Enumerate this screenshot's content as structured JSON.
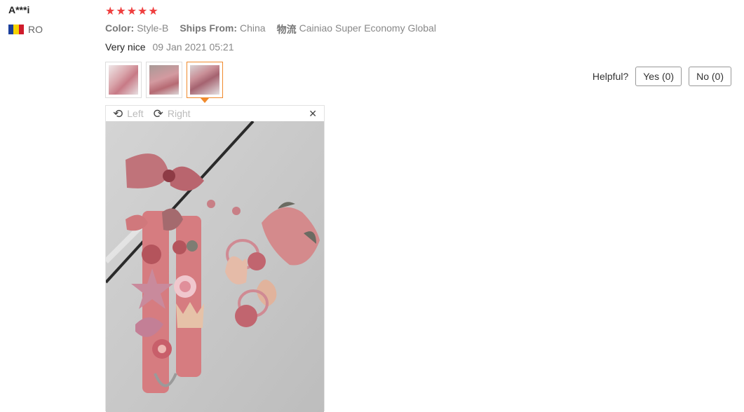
{
  "review": {
    "user_name": "A***i",
    "country_code": "RO",
    "flag_colors": [
      "#1a3e9c",
      "#f4d300",
      "#cf1b2b"
    ],
    "rating": 5,
    "color_label": "Color:",
    "color_value": "Style-B",
    "ships_label": "Ships From:",
    "ships_value": "China",
    "logistics_label": "物流",
    "logistics_value": "Cainiao Super Economy Global",
    "text": "Very nice",
    "date": "09 Jan 2021 05:21",
    "helpful_label": "Helpful?",
    "yes_label": "Yes (0)",
    "no_label": "No (0)"
  },
  "viewer": {
    "left_label": "Left",
    "right_label": "Right",
    "close_symbol": "✕"
  },
  "colors": {
    "accent": "#f08a2c",
    "star": "#ef3f3f"
  }
}
